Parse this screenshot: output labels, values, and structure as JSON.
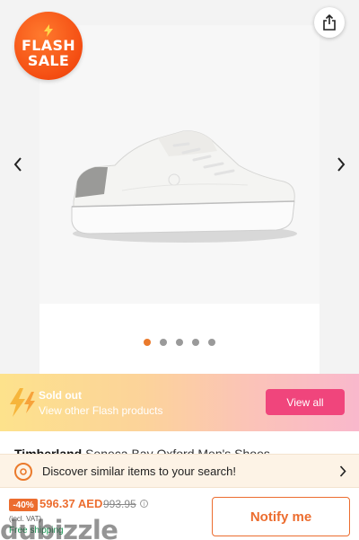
{
  "flash_badge": {
    "line1": "FLASH",
    "line2": "SALE"
  },
  "gallery": {
    "image_count": 5,
    "active_index": 0
  },
  "flash_banner": {
    "title": "Sold out",
    "subtitle": "View other Flash products",
    "button_label": "View all"
  },
  "product": {
    "brand": "Timberland",
    "name": "Seneca Bay Oxford Men's Shoes"
  },
  "discover": {
    "label": "Discover similar items to your search!"
  },
  "pricing": {
    "discount": "-40%",
    "price": "596.37 AED",
    "old_price": "993.95",
    "vat_note": "incl. VAT",
    "shipping": "Free shipping"
  },
  "cta": {
    "notify_label": "Notify me"
  },
  "watermark": "dubizzle",
  "colors": {
    "accent": "#ec6d2f",
    "pink": "#f0457c"
  },
  "icons": [
    "bolt-icon",
    "share-icon",
    "chevron-left-icon",
    "chevron-right-icon",
    "lightning-icon",
    "discover-icon",
    "chevron-right-small-icon",
    "info-icon"
  ]
}
